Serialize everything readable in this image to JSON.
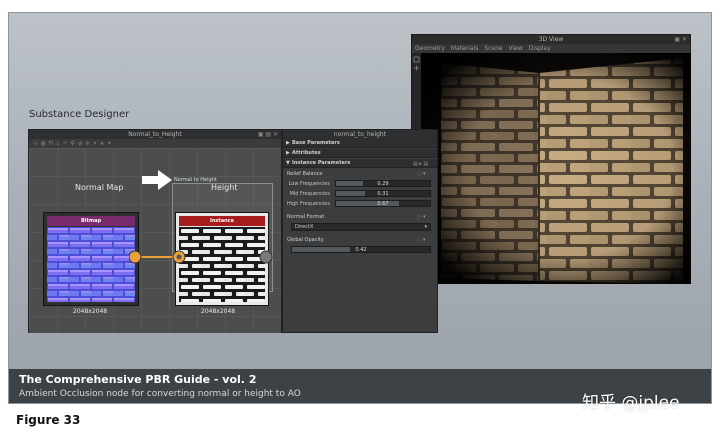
{
  "slide": {
    "app_label": "Substance Designer",
    "caption_title": "The Comprehensive PBR Guide - vol. 2",
    "caption_subtitle": "Ambient Occlusion node for converting normal or height to AO"
  },
  "graph_window": {
    "title": "Normal_to_Height",
    "toolbar": "⊹ ▤ ⊓ ↓ ─ ⚲ ◎ ⊙ ▾ ✲ ▾",
    "left_label": "Normal Map",
    "right_label": "Height",
    "frame_label": "Normal to Height",
    "bitmap_node": {
      "header": "Bitmap",
      "resolution": "2048x2048",
      "header_color": "#7a2b6e"
    },
    "instance_node": {
      "header": "Instance",
      "resolution": "2048x2048",
      "header_color": "#a61b1b"
    }
  },
  "param_panel": {
    "title": "normal_to_height",
    "sections": [
      "Base Parameters",
      "Attributes",
      "Instance Parameters"
    ],
    "relief_balance": {
      "label": "Relief Balance",
      "rows": [
        {
          "label": "Low Frequencies",
          "value": "0.29",
          "fraction": 0.29
        },
        {
          "label": "Mid Frequencies",
          "value": "0.31",
          "fraction": 0.31
        },
        {
          "label": "High Frequencies",
          "value": "0.67",
          "fraction": 0.67
        }
      ]
    },
    "normal_format": {
      "label": "Normal Format",
      "value": "DirectX"
    },
    "global_opacity": {
      "label": "Global Opacity",
      "value": "0.42",
      "fraction": 0.42
    }
  },
  "view3d": {
    "title": "3D View",
    "menu": [
      "Geometry",
      "Materials",
      "Scene",
      "View",
      "Display"
    ]
  },
  "watermark": "知乎 @jplee",
  "figure_label": "Figure 33"
}
